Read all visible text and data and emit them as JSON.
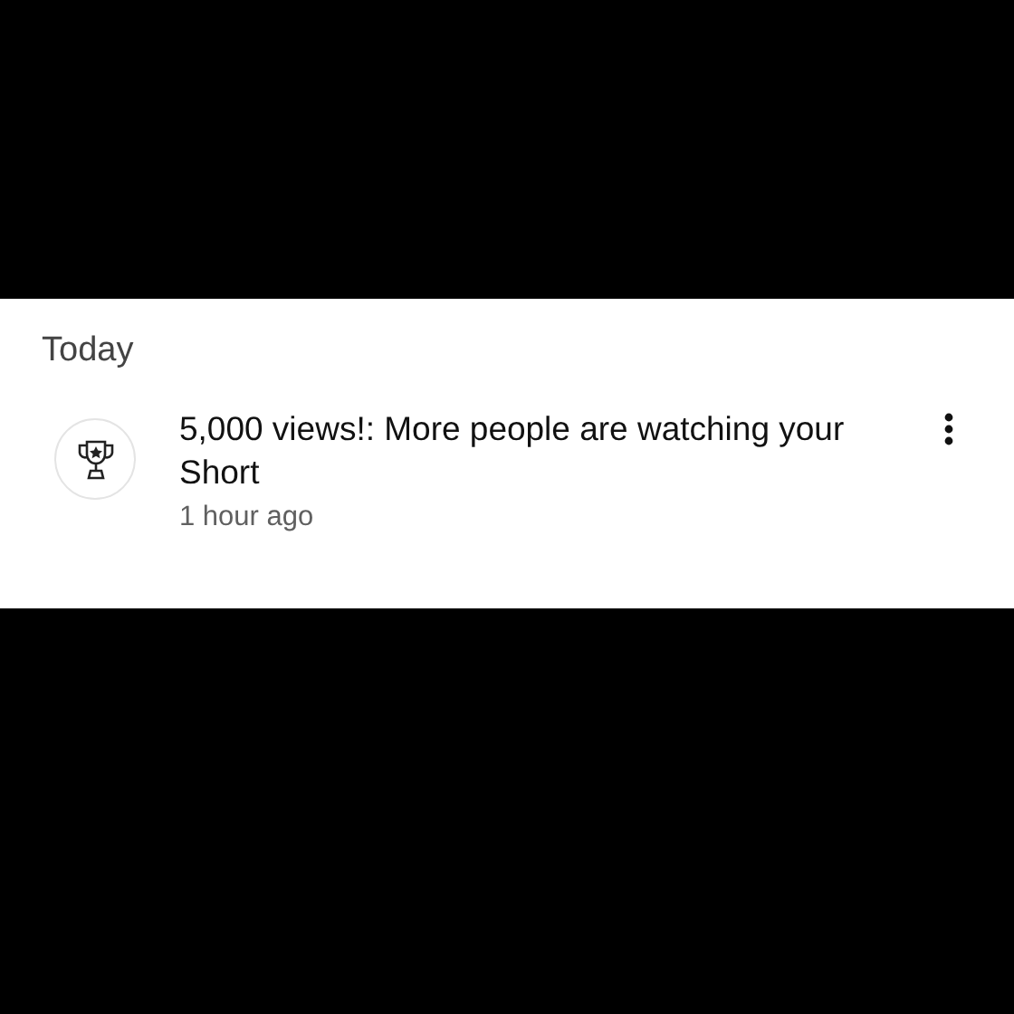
{
  "section": {
    "title": "Today"
  },
  "notifications": [
    {
      "message": "5,000 views!: More people are watching your Short",
      "time": "1 hour ago"
    }
  ]
}
